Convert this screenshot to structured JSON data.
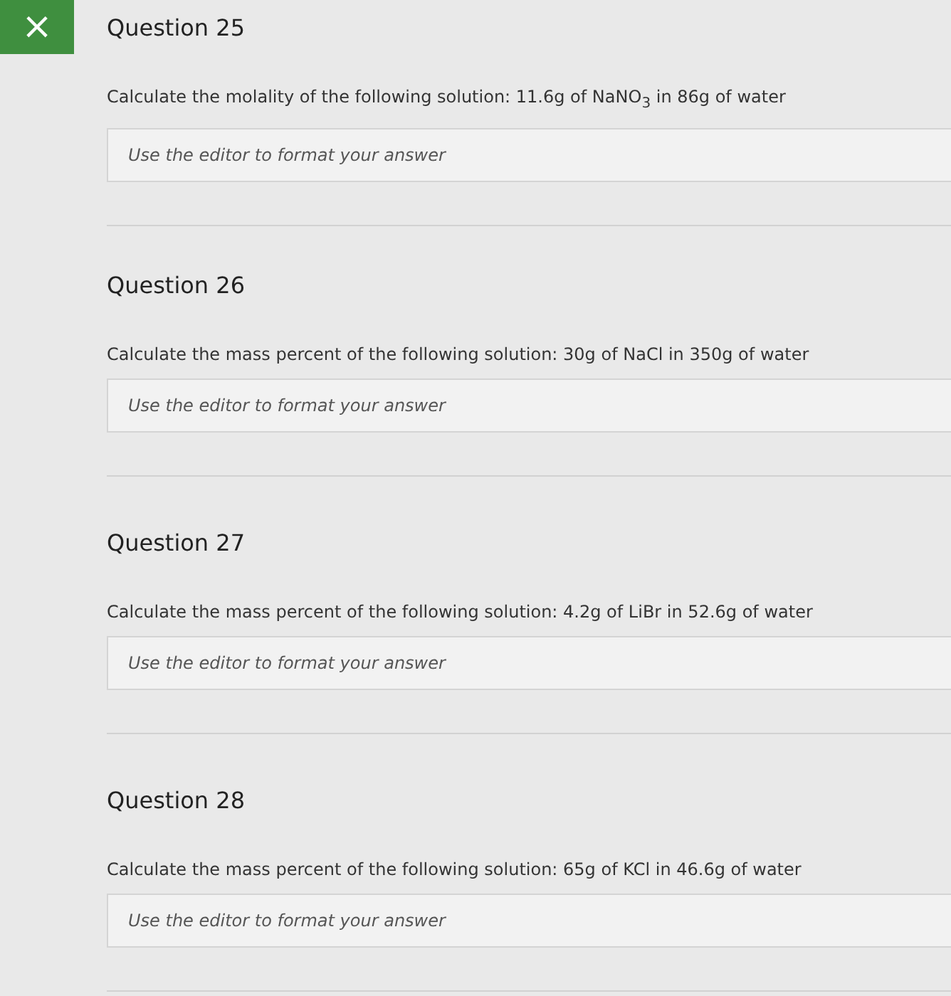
{
  "close_button": {
    "label": "×"
  },
  "questions": [
    {
      "title": "Question 25",
      "prompt": "Calculate the molality of the following solution: 11.6g of NaNO$_{3}$ in 86g of water",
      "answer": {
        "placeholder": "Use the editor to format your answer"
      }
    },
    {
      "title": "Question 26",
      "prompt": "Calculate the mass percent of the following solution: 30g of NaCl in 350g of water",
      "answer": {
        "placeholder": "Use the editor to format your answer"
      }
    },
    {
      "title": "Question 27",
      "prompt": "Calculate the mass percent of the following solution: 4.2g of LiBr in 52.6g of water",
      "answer": {
        "placeholder": "Use the editor to format your answer"
      }
    },
    {
      "title": "Question 28",
      "prompt": "Calculate the mass percent of the following solution: 65g of KCl in 46.6g of water",
      "answer": {
        "placeholder": "Use the editor to format your answer"
      }
    }
  ]
}
